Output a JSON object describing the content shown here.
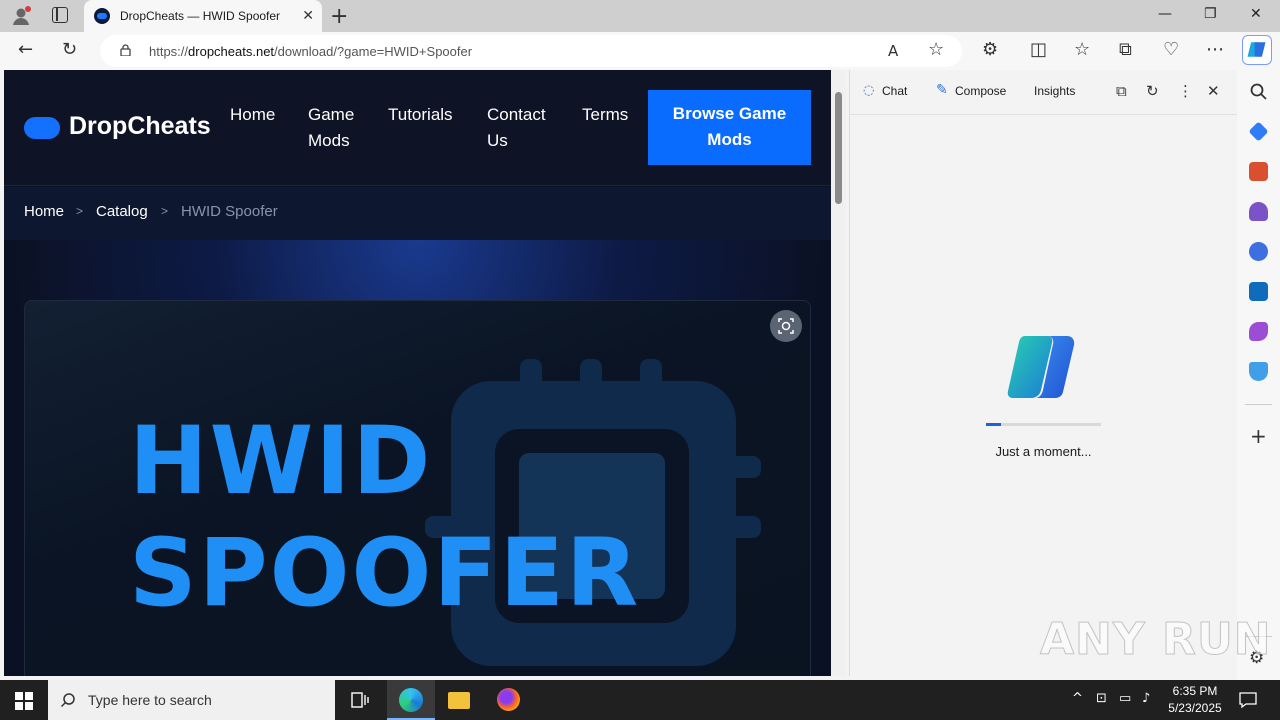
{
  "browser": {
    "tab": {
      "title": "DropCheats — HWID Spoofer"
    },
    "address": {
      "url_prefix": "https://",
      "url_domain": "dropcheats.net",
      "url_path": "/download/?game=HWID+Spoofer"
    }
  },
  "site": {
    "logo": "DropCheats",
    "nav": [
      {
        "label_1": "Home",
        "label_2": ""
      },
      {
        "label_1": "Game",
        "label_2": "Mods"
      },
      {
        "label_1": "Tutorials",
        "label_2": ""
      },
      {
        "label_1": "Contact",
        "label_2": "Us"
      },
      {
        "label_1": "Terms",
        "label_2": ""
      }
    ],
    "cta": {
      "line1": "Browse Game",
      "line2": "Mods"
    },
    "breadcrumb": [
      "Home",
      "Catalog",
      "HWID Spoofer"
    ],
    "hero": {
      "line1": "HWID",
      "line2": "SPOOFER"
    },
    "colors": {
      "accent": "#0a6bff",
      "hero_text": "#1f8ff5",
      "bg": "#0b1124"
    }
  },
  "copilot": {
    "tabs": [
      "Chat",
      "Compose",
      "Insights"
    ],
    "loading_text": "Just a moment...",
    "progress_fraction": 0.13
  },
  "taskbar": {
    "search_placeholder": "Type here to search",
    "time": "6:35 PM",
    "date": "5/23/2025"
  },
  "watermark": "ANY RUN"
}
